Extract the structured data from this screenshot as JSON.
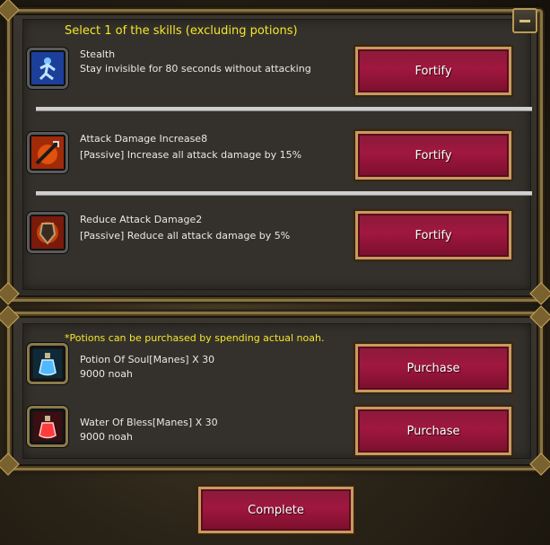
{
  "skills_panel": {
    "header": "Select 1 of the skills (excluding potions)",
    "skills": [
      {
        "name": "Stealth",
        "description": "Stay invisible for 80 seconds without attacking",
        "button_label": "Fortify",
        "icon": "stealth-icon"
      },
      {
        "name": "Attack Damage Increase8",
        "description": "[Passive] Increase all attack damage by 15%",
        "button_label": "Fortify",
        "icon": "sword-icon"
      },
      {
        "name": "Reduce Attack Damage2",
        "description": "[Passive] Reduce all attack damage by 5%",
        "button_label": "Fortify",
        "icon": "shield-icon"
      }
    ]
  },
  "potions_panel": {
    "note": "*Potions can be purchased by spending actual noah.",
    "potions": [
      {
        "name": "Potion Of Soul[Manes] X 30",
        "price": "9000 noah",
        "button_label": "Purchase",
        "icon": "blue-potion-icon",
        "color": "#4fb8ff"
      },
      {
        "name": "Water Of Bless[Manes] X 30",
        "price": "9000 noah",
        "button_label": "Purchase",
        "icon": "red-potion-icon",
        "color": "#ff3b3b"
      }
    ]
  },
  "complete_button": {
    "label": "Complete"
  },
  "colors": {
    "header_text": "#f5e62a",
    "button_face": "#a0173f",
    "button_border": "#c89a5e",
    "frame_gold": "#8a7442"
  }
}
